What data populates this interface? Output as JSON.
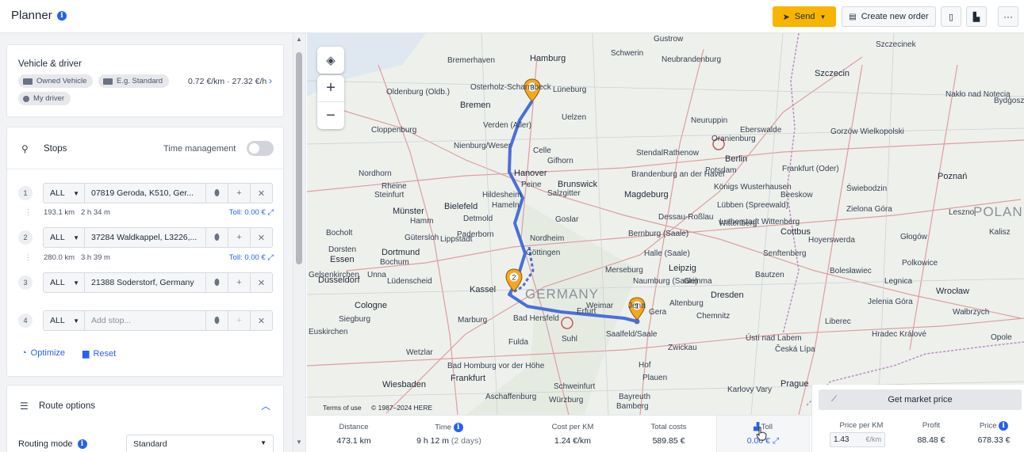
{
  "header": {
    "title": "Planner",
    "send_label": "Send",
    "create_order_label": "Create new order"
  },
  "vehicle": {
    "title": "Vehicle & driver",
    "chips": [
      "Owned Vehicle",
      "E.g. Standard",
      "My driver"
    ],
    "cost": "0.72 €/km · 27.32 €/h"
  },
  "stops": {
    "title": "Stops",
    "time_management_label": "Time management",
    "time_management_on": false,
    "items": [
      {
        "num": "1",
        "filter": "ALL",
        "address": "07819 Geroda, K510, Ger..."
      },
      {
        "num": "2",
        "filter": "ALL",
        "address": "37284 Waldkappel, L3226,..."
      },
      {
        "num": "3",
        "filter": "ALL",
        "address": "21388 Soderstorf, Germany"
      },
      {
        "num": "4",
        "filter": "ALL",
        "address": "",
        "placeholder": "Add stop..."
      }
    ],
    "legs": [
      {
        "distance": "193.1 km",
        "time": "2 h 34 m",
        "toll": "Toll: 0.00 €"
      },
      {
        "distance": "280.0 km",
        "time": "3 h 39 m",
        "toll": "Toll: 0.00 €"
      }
    ],
    "optimize_label": "Optimize",
    "reset_label": "Reset"
  },
  "route_options": {
    "title": "Route options",
    "routing_mode_label": "Routing mode",
    "routing_mode_value": "Standard"
  },
  "map": {
    "terms": "Terms of use",
    "copyright": "© 1987–2024 HERE",
    "cities": [
      "Gustrow",
      "Szczecinek",
      "Bremerhaven",
      "Hamburg",
      "Schwerin",
      "Neubrandenburg",
      "Szczecin",
      "Oldenburg (Oldb.)",
      "Osterholz-Scharmbeck",
      "Bremen",
      "Lüneburg",
      "Nakło nad Notecią",
      "Bydgoszcz",
      "Uelzen",
      "Neuruppin",
      "Eberswalde",
      "Gorzów Wielkopolski",
      "Cloppenburg",
      "Verden (Aller)",
      "Oranienburg",
      "Berlin",
      "Nienburg/Weser",
      "Celle",
      "Gifhorn",
      "Stendal",
      "Rathenow",
      "Potsdam",
      "Frankfurt (Oder)",
      "Poznań",
      "Nordhorn",
      "Hanover",
      "Brunswick",
      "Brandenburg an der Havel",
      "Rheine",
      "Peine",
      "Salzgitter",
      "Magdeburg",
      "Königs Wusterhausen",
      "Świebodzin",
      "Steinfurt",
      "Hildesheim",
      "Lübben (Spreewald)",
      "Beeskow",
      "Münster",
      "Bielefeld",
      "Hameln",
      "Goslar",
      "Dessau-Roßlau",
      "Zielona Góra",
      "Leszno",
      "Detmold",
      "Cottbus",
      "Bocholt",
      "Gütersloh",
      "Wittenberg",
      "Lutherstadt Wittenberg",
      "Hoyerswerda",
      "Paderborn",
      "Nordheim",
      "Bernburg (Saale)",
      "Głogów",
      "Kalisz",
      "Dorsten",
      "Dortmund",
      "Halle (Saale)",
      "Senftenberg",
      "Essen",
      "Göttingen",
      "Leipzig",
      "Bautzen",
      "Polkowice",
      "Düsseldorf",
      "Lüdenscheid",
      "Merseburg",
      "Naumburg (Saale)",
      "Grimma",
      "Bolesławiec",
      "Legnica",
      "Wrocław",
      "Cologne",
      "Kassel",
      "Weimar",
      "Jena",
      "Gera",
      "Altenburg",
      "Dresden",
      "Jelenia Góra",
      "Wałbrzych",
      "Siegburg",
      "Marburg",
      "Bad Hersfeld",
      "Erfurt",
      "Saalfeld/Saale",
      "Zwickau",
      "Chemnitz",
      "Liberec",
      "Opole",
      "Euskirchen",
      "Fulda",
      "Suhl",
      "Hof",
      "Plauen",
      "Ústí nad Labem",
      "Hradec Králové",
      "Wetzlar",
      "Bad Homburg vor der Höhe",
      "Schweinfurt",
      "Karlovy Vary",
      "Česká Lípa",
      "Prague",
      "Wiesbaden",
      "Frankfurt",
      "Bayreuth",
      "Aschaffenburg",
      "Würzburg",
      "Bamberg",
      "Lippstadt",
      "Hamm",
      "Unna",
      "Gelsenkirchen",
      "Bochum"
    ],
    "countries": [
      "GERMANY",
      "POLAND"
    ]
  },
  "summary": {
    "distance_label": "Distance",
    "distance_value": "473.1 km",
    "time_label": "Time",
    "time_value": "9 h 12 m",
    "time_days": "(2 days)",
    "cpk_label": "Cost per KM",
    "cpk_value": "1.24 €/km",
    "total_label": "Total costs",
    "total_value": "589.85 €",
    "toll_label": "Toll",
    "toll_value": "0.00 €"
  },
  "market": {
    "button_label": "Get market price",
    "ppk_label": "Price per KM",
    "ppk_value": "1.43",
    "ppk_unit": "€/km",
    "profit_label": "Profit",
    "profit_value": "88.48 €",
    "price_label": "Price",
    "price_value": "678.33 €"
  },
  "colors": {
    "accent": "#2563eb",
    "send": "#f7b500",
    "route": "#4a6fd8",
    "pin": "#f5a623"
  }
}
